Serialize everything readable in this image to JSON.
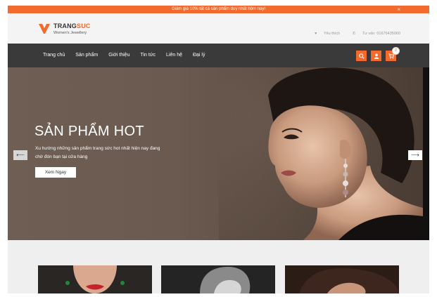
{
  "promo": {
    "text": "Giảm giá 10% tất cả sản phẩm duy nhất hôm nay!",
    "close_label": "×"
  },
  "header": {
    "logo": {
      "brand_main": "TRANG",
      "brand_accent": "SUC",
      "tagline": "Women's Jewellery"
    },
    "wishlist": "Yêu thích",
    "support": "Tư vấn: 01676435060"
  },
  "nav": {
    "items": [
      {
        "label": "Trang chủ"
      },
      {
        "label": "Sản phẩm"
      },
      {
        "label": "Giới thiệu"
      },
      {
        "label": "Tin tức"
      },
      {
        "label": "Liên hệ"
      },
      {
        "label": "Đại lý"
      }
    ],
    "cart_count": "0"
  },
  "hero": {
    "title": "SẢN PHẨM HOT",
    "description": "Xu hướng những sản phẩm trang sức hot nhất hiện nay đang chờ đón bạn tại cửa hàng",
    "cta_label": "Xem Ngay",
    "prev_label": "⟵",
    "next_label": "⟶"
  },
  "colors": {
    "accent": "#f26a2e",
    "nav_bg": "#3a3a3a"
  }
}
